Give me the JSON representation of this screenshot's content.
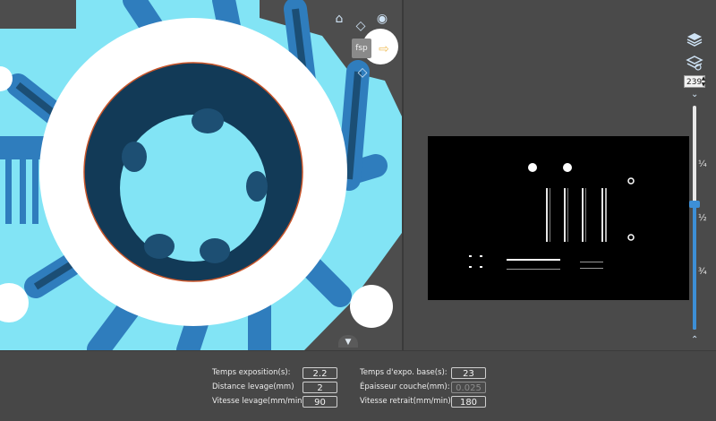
{
  "viewport": {
    "fsp_label": "fsp"
  },
  "layer": {
    "current": "239"
  },
  "slider": {
    "tick_top": "¼",
    "tick_mid": "½",
    "tick_bottom": "¾",
    "position_fraction": 0.44
  },
  "params": {
    "exposure_time": {
      "label": "Temps exposition(s):",
      "value": "2.2"
    },
    "base_exposure": {
      "label": "Temps d'expo. base(s):",
      "value": "23"
    },
    "lift_distance": {
      "label": "Distance levage(mm)",
      "value": "2"
    },
    "layer_thickness": {
      "label": "Épaisseur couche(mm):",
      "value": "0.025"
    },
    "lift_speed": {
      "label": "Vitesse levage(mm/min):",
      "value": "90"
    },
    "retract_speed": {
      "label": "Vitesse retrait(mm/min):",
      "value": "180"
    }
  },
  "colors": {
    "accent": "#3d8fd6",
    "scene_bg": "#82e4f5",
    "model_dark": "#123a57",
    "model_mid": "#2f7dbd"
  }
}
